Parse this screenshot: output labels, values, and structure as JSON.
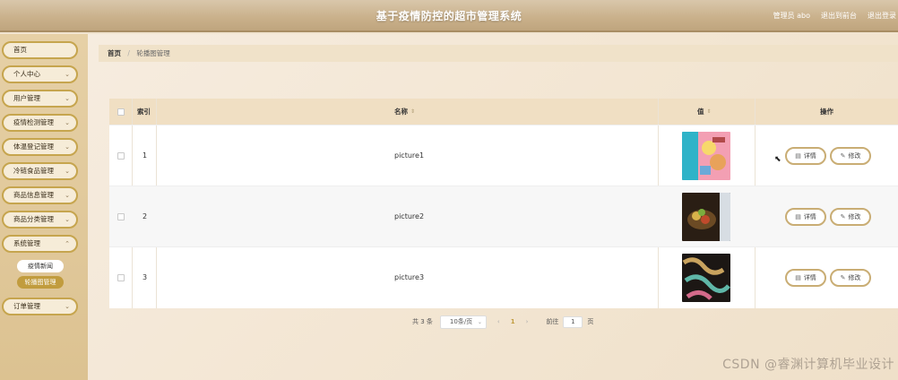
{
  "header": {
    "title": "基于疫情防控的超市管理系统",
    "links": [
      "管理员 abo",
      "退出到前台",
      "退出登录"
    ]
  },
  "sidebar": {
    "items": [
      {
        "label": "首页",
        "has_chevron": false
      },
      {
        "label": "个人中心",
        "has_chevron": true
      },
      {
        "label": "用户管理",
        "has_chevron": true
      },
      {
        "label": "疫情检测管理",
        "has_chevron": true
      },
      {
        "label": "体温登记管理",
        "has_chevron": true
      },
      {
        "label": "冷链食品管理",
        "has_chevron": true
      },
      {
        "label": "商品信息管理",
        "has_chevron": true
      },
      {
        "label": "商品分类管理",
        "has_chevron": true
      },
      {
        "label": "系统管理",
        "has_chevron": true
      },
      {
        "label": "订单管理",
        "has_chevron": true
      }
    ],
    "sub_items": [
      {
        "label": "疫情新闻",
        "active": false
      },
      {
        "label": "轮播图管理",
        "active": true
      }
    ]
  },
  "breadcrumb": {
    "home": "首页",
    "separator": "/",
    "current": "轮播图管理"
  },
  "table": {
    "columns": {
      "index": "索引",
      "name": "名称",
      "value": "值",
      "actions": "操作"
    },
    "rows": [
      {
        "index": "1",
        "name": "picture1"
      },
      {
        "index": "2",
        "name": "picture2"
      },
      {
        "index": "3",
        "name": "picture3"
      }
    ],
    "detail_label": "详情",
    "edit_label": "修改"
  },
  "pagination": {
    "total": "共 3 条",
    "page_size": "10条/页",
    "current_page": "1",
    "goto_label": "前往",
    "goto_value": "1",
    "page_unit": "页"
  },
  "watermark": "CSDN @睿渊计算机毕业设计",
  "colors": {
    "accent": "#c19c3e",
    "header": "#c9b08a",
    "sidebar": "#dcc291"
  }
}
